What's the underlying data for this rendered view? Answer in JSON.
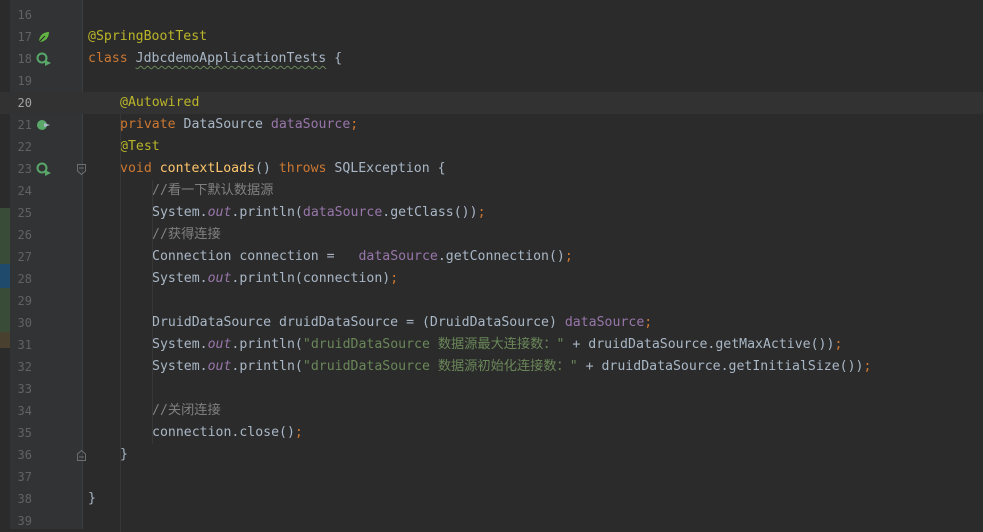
{
  "lines": [
    {
      "num": "16",
      "tokens": []
    },
    {
      "num": "17",
      "icon": "spring-leaf",
      "tokens": [
        {
          "t": "@SpringBootTest",
          "c": "ann"
        }
      ]
    },
    {
      "num": "18",
      "icon": "run-test",
      "tokens": [
        {
          "t": "class ",
          "c": "kw"
        },
        {
          "t": "JdbcdemoApplicationTests",
          "c": "plain",
          "typo": true
        },
        {
          "t": " {",
          "c": "plain"
        }
      ]
    },
    {
      "num": "19",
      "tokens": []
    },
    {
      "num": "20",
      "current": true,
      "indent": 1,
      "tokens": [
        {
          "t": "@Autowired",
          "c": "ann"
        }
      ]
    },
    {
      "num": "21",
      "icon": "bean-link",
      "indent": 1,
      "tokens": [
        {
          "t": "private ",
          "c": "kw"
        },
        {
          "t": "DataSource ",
          "c": "plain"
        },
        {
          "t": "dataSource",
          "c": "fld"
        },
        {
          "t": ";",
          "c": "kw"
        }
      ]
    },
    {
      "num": "22",
      "indent": 1,
      "tokens": [
        {
          "t": "@Test",
          "c": "ann"
        }
      ]
    },
    {
      "num": "23",
      "icon": "run-test",
      "fold": "open",
      "indent": 1,
      "tokens": [
        {
          "t": "void ",
          "c": "kw"
        },
        {
          "t": "contextLoads",
          "c": "meth"
        },
        {
          "t": "() ",
          "c": "plain"
        },
        {
          "t": "throws ",
          "c": "kw"
        },
        {
          "t": "SQLException {",
          "c": "plain"
        }
      ]
    },
    {
      "num": "24",
      "indent": 2,
      "tokens": [
        {
          "t": "//看一下默认数据源",
          "c": "cmt"
        }
      ]
    },
    {
      "num": "25",
      "indent": 2,
      "tokens": [
        {
          "t": "System.",
          "c": "plain"
        },
        {
          "t": "out",
          "c": "sfld"
        },
        {
          "t": ".println(",
          "c": "plain"
        },
        {
          "t": "dataSource",
          "c": "fld"
        },
        {
          "t": ".getClass())",
          "c": "plain"
        },
        {
          "t": ";",
          "c": "kw"
        }
      ]
    },
    {
      "num": "26",
      "indent": 2,
      "tokens": [
        {
          "t": "//获得连接",
          "c": "cmt"
        }
      ]
    },
    {
      "num": "27",
      "indent": 2,
      "tokens": [
        {
          "t": "Connection connection =   ",
          "c": "plain"
        },
        {
          "t": "dataSource",
          "c": "fld"
        },
        {
          "t": ".getConnection()",
          "c": "plain"
        },
        {
          "t": ";",
          "c": "kw"
        }
      ]
    },
    {
      "num": "28",
      "indent": 2,
      "tokens": [
        {
          "t": "System.",
          "c": "plain"
        },
        {
          "t": "out",
          "c": "sfld"
        },
        {
          "t": ".println(connection)",
          "c": "plain"
        },
        {
          "t": ";",
          "c": "kw"
        }
      ]
    },
    {
      "num": "29",
      "tokens": []
    },
    {
      "num": "30",
      "indent": 2,
      "tokens": [
        {
          "t": "DruidDataSource druidDataSource = (DruidDataSource) ",
          "c": "plain"
        },
        {
          "t": "dataSource",
          "c": "fld"
        },
        {
          "t": ";",
          "c": "kw"
        }
      ]
    },
    {
      "num": "31",
      "indent": 2,
      "tokens": [
        {
          "t": "System.",
          "c": "plain"
        },
        {
          "t": "out",
          "c": "sfld"
        },
        {
          "t": ".println(",
          "c": "plain"
        },
        {
          "t": "\"druidDataSource 数据源最大连接数：\"",
          "c": "str"
        },
        {
          "t": " + druidDataSource.getMaxActive())",
          "c": "plain"
        },
        {
          "t": ";",
          "c": "kw"
        }
      ]
    },
    {
      "num": "32",
      "indent": 2,
      "tokens": [
        {
          "t": "System.",
          "c": "plain"
        },
        {
          "t": "out",
          "c": "sfld"
        },
        {
          "t": ".println(",
          "c": "plain"
        },
        {
          "t": "\"druidDataSource 数据源初始化连接数：\"",
          "c": "str"
        },
        {
          "t": " + druidDataSource.getInitialSize())",
          "c": "plain"
        },
        {
          "t": ";",
          "c": "kw"
        }
      ]
    },
    {
      "num": "33",
      "tokens": []
    },
    {
      "num": "34",
      "indent": 2,
      "tokens": [
        {
          "t": "//关闭连接",
          "c": "cmt"
        }
      ]
    },
    {
      "num": "35",
      "indent": 2,
      "tokens": [
        {
          "t": "connection.close()",
          "c": "plain"
        },
        {
          "t": ";",
          "c": "kw"
        }
      ]
    },
    {
      "num": "36",
      "fold": "close",
      "indent": 1,
      "tokens": [
        {
          "t": "}",
          "c": "plain"
        }
      ]
    },
    {
      "num": "37",
      "tokens": []
    },
    {
      "num": "38",
      "tokens": [
        {
          "t": "}",
          "c": "plain"
        }
      ]
    },
    {
      "num": "39",
      "tokens": []
    }
  ],
  "colors": {
    "background": "#2b2b2b",
    "gutter": "#313335",
    "keyword": "#cc7832",
    "annotation": "#bbb529",
    "field": "#9876aa",
    "method": "#ffc66d",
    "string": "#6a8759",
    "comment": "#808080"
  }
}
